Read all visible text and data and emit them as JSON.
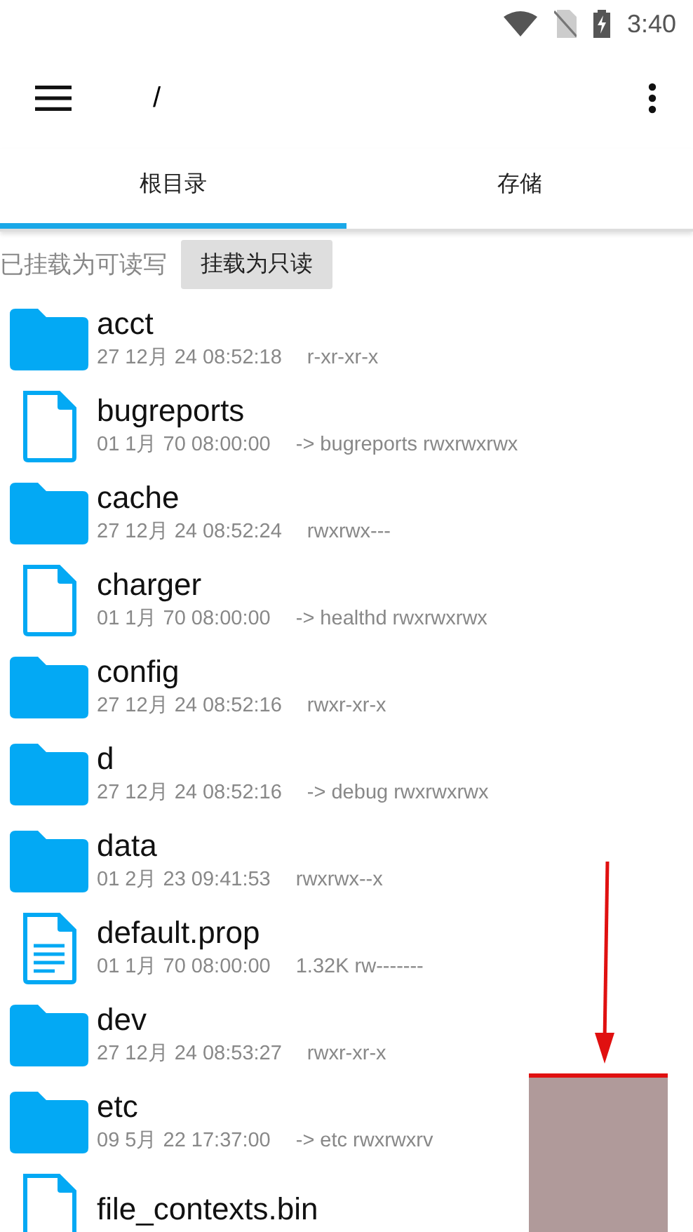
{
  "status_bar": {
    "time": "3:40"
  },
  "toolbar": {
    "path": "/"
  },
  "tabs": [
    {
      "label": "根目录",
      "selected": true
    },
    {
      "label": "存储",
      "selected": false
    }
  ],
  "mount": {
    "status": "已挂载为可读写",
    "button": "挂载为只读"
  },
  "files": [
    {
      "kind": "folder",
      "name": "acct",
      "date": "27 12月 24 08:52:18",
      "info": "r-xr-xr-x"
    },
    {
      "kind": "file",
      "name": "bugreports",
      "date": "01 1月 70 08:00:00",
      "info": "-> bugreports  rwxrwxrwx"
    },
    {
      "kind": "folder",
      "name": "cache",
      "date": "27 12月 24 08:52:24",
      "info": "rwxrwx---"
    },
    {
      "kind": "file",
      "name": "charger",
      "date": "01 1月 70 08:00:00",
      "info": "-> healthd  rwxrwxrwx"
    },
    {
      "kind": "folder",
      "name": "config",
      "date": "27 12月 24 08:52:16",
      "info": "rwxr-xr-x"
    },
    {
      "kind": "folder",
      "name": "d",
      "date": "27 12月 24 08:52:16",
      "info": "-> debug  rwxrwxrwx"
    },
    {
      "kind": "folder",
      "name": "data",
      "date": "01 2月 23 09:41:53",
      "info": "rwxrwx--x"
    },
    {
      "kind": "text",
      "name": "default.prop",
      "date": "01 1月 70 08:00:00",
      "info": "1.32K  rw-------"
    },
    {
      "kind": "folder",
      "name": "dev",
      "date": "27 12月 24 08:53:27",
      "info": "rwxr-xr-x"
    },
    {
      "kind": "folder",
      "name": "etc",
      "date": "09 5月 22 17:37:00",
      "info": "-> etc  rwxrwxrv"
    },
    {
      "kind": "file",
      "name": "file_contexts.bin"
    }
  ]
}
